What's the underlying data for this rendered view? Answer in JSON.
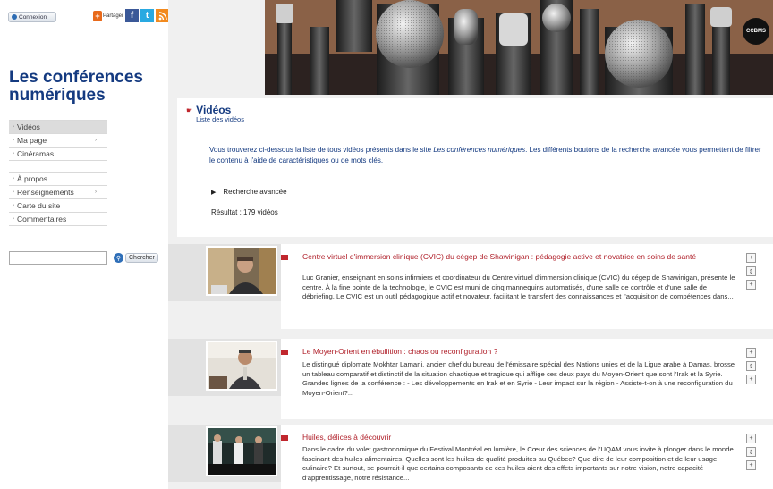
{
  "sidebar": {
    "connect_label": "Connexion",
    "share_label": "Partager",
    "site_title": "Les conférences numériques",
    "nav_primary": [
      {
        "label": "Vidéos",
        "active": true,
        "has_submenu": false
      },
      {
        "label": "Ma page",
        "active": false,
        "has_submenu": true
      },
      {
        "label": "Cinéramas",
        "active": false,
        "has_submenu": false
      }
    ],
    "nav_secondary": [
      {
        "label": "À propos",
        "has_submenu": false
      },
      {
        "label": "Renseignements",
        "has_submenu": true
      },
      {
        "label": "Carte du site",
        "has_submenu": false
      },
      {
        "label": "Commentaires",
        "has_submenu": false
      }
    ],
    "search": {
      "value": "",
      "button_label": "Chercher"
    }
  },
  "header": {
    "logo_text": "CCBMS"
  },
  "main": {
    "heading": "Vidéos",
    "subheading": "Liste des vidéos",
    "intro_before": "Vous trouverez ci-dessous la liste de tous vidéos présents dans le site ",
    "intro_site": "Les conférences numériques",
    "intro_after": ". Les différents boutons de la recherche avancée vous permettent de filtrer le contenu à l'aide de caractéristiques ou de mots clés.",
    "advanced_search_label": "Recherche avancée",
    "result_label": "Résultat : 179 vidéos"
  },
  "videos": [
    {
      "title": "Centre virtuel d'immersion clinique (CVIC) du cégep de Shawinigan : pédagogie active et novatrice en soins de santé",
      "description": "Luc Granier, enseignant en soins infirmiers et coordinateur du Centre virtuel d'immersion clinique (CVIC) du cégep de Shawinigan, présente le centre. À la fine pointe de la technologie, le CVIC est muni de cinq mannequins automatisés, d'une salle de contrôle et d'une salle de débriefing. Le CVIC est un outil pédagogique actif et novateur, facilitant le transfert des connaissances et l'acquisition de compétences dans..."
    },
    {
      "title": "Le Moyen-Orient en ébullition : chaos ou reconfiguration ?",
      "description": "Le distingué diplomate Mokhtar Lamani, ancien chef du bureau de l'émissaire spécial des Nations unies et de la Ligue arabe à Damas, brosse un tableau comparatif et distinctif de la situation chaotique et tragique qui afflige ces deux pays du Moyen-Orient que sont l'Irak et la Syrie. Grandes lignes de la conférence : - Les développements en Irak et en Syrie - Leur impact sur la région - Assiste-t-on à une reconfiguration du Moyen-Orient?..."
    },
    {
      "title": "Huiles, délices à découvrir",
      "description": "Dans le cadre du volet gastronomique du Festival Montréal en lumière, le Cœur des sciences de l'UQAM vous invite à plonger dans le monde fascinant des huiles alimentaires. Quelles sont les huiles de qualité produites au Québec? Que dire de leur composition et de leur usage culinaire? Et surtout, se pourrait-il que certains composants de ces huiles aient des effets importants sur notre vision, notre capacité d'apprentissage, notre résistance..."
    }
  ],
  "colors": {
    "brand_blue": "#143a80",
    "accent_red": "#c0262d"
  }
}
